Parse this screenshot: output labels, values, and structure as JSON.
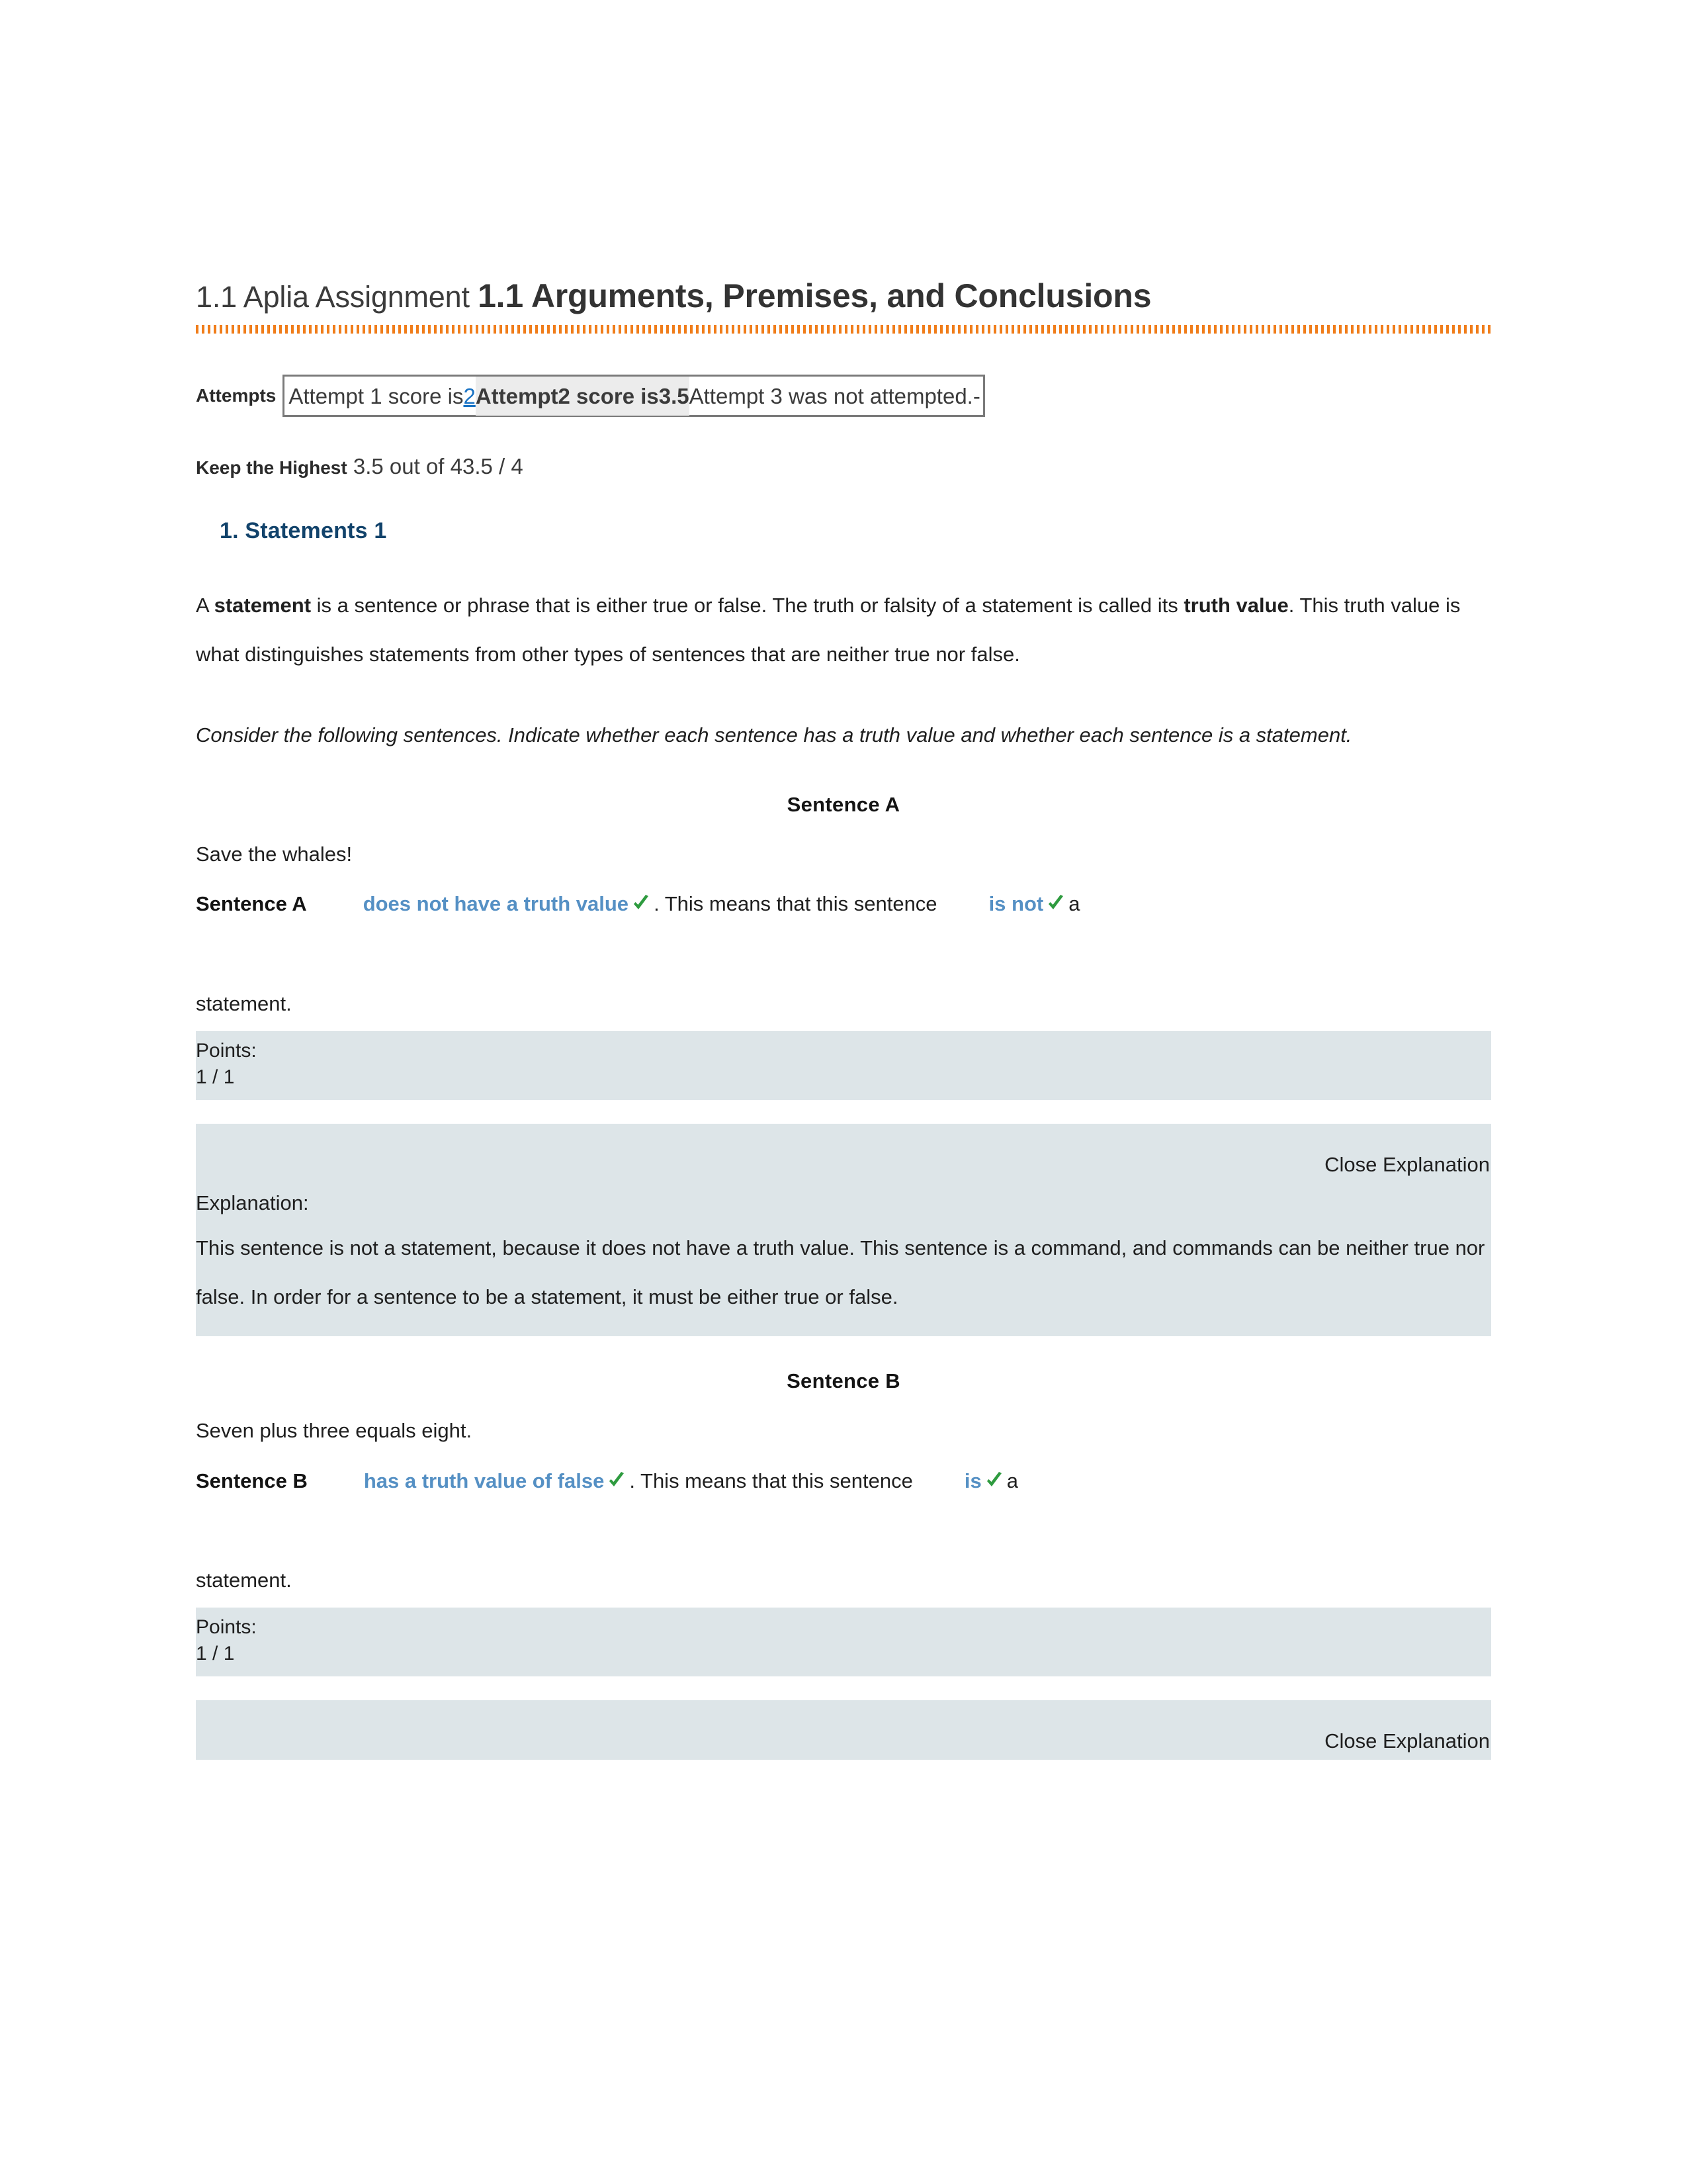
{
  "document": {
    "title_lead": "1.1 Aplia Assignment ",
    "title_strong": "1.1 Arguments, Premises, and Conclusions"
  },
  "attempts": {
    "label": "Attempts",
    "segment_1": "Attempt 1 score is",
    "segment_link": "2",
    "segment_highlight": "Attempt2 score is3.5",
    "segment_tail": "Attempt 3 was not attempted.-"
  },
  "keep_highest": {
    "label": "Keep the Highest",
    "value": " 3.5 out of 43.5 / 4"
  },
  "section": {
    "heading": "1. Statements 1"
  },
  "intro": {
    "para1_part1": "A ",
    "para1_bold1": "statement",
    "para1_part2": " is a sentence or phrase that is either true or false. The truth or falsity of a statement is called its ",
    "para1_bold2": "truth value",
    "para1_part3": ". This truth value is what distinguishes statements from other types of sentences that are neither true nor false.",
    "para2": "Consider the following sentences. Indicate whether each sentence has a truth value and whether each sentence is a statement."
  },
  "sentence_a": {
    "heading": "Sentence A",
    "prompt": "Save the whales!",
    "label": "Sentence A",
    "choice1": "does not have a truth value",
    "mid_text": ". This means that this sentence",
    "choice2": "is not",
    "article": "a",
    "tail": "statement.",
    "points_label": "Points:",
    "points_value": "1 / 1",
    "close_explanation": "Close Explanation",
    "explanation_label": "Explanation:",
    "explanation_body": "This sentence is not a statement, because it does not have a truth value. This sentence is a command, and commands can be neither true nor false. In order for a sentence to be a statement, it must be either true or false."
  },
  "sentence_b": {
    "heading": "Sentence B",
    "prompt": "Seven plus three equals eight.",
    "label": "Sentence B",
    "choice1": "has a truth value of false",
    "mid_text": ". This means that this sentence",
    "choice2": "is",
    "article": "a",
    "tail": "statement.",
    "points_label": "Points:",
    "points_value": "1 / 1",
    "close_explanation": "Close Explanation"
  },
  "colors": {
    "accent_orange": "#f07d1a",
    "heading_navy": "#12436b",
    "choice_blue": "#5590c4",
    "check_green": "#2e9b3f",
    "band_bg": "#dde5e8",
    "link_blue": "#1a73c4"
  }
}
